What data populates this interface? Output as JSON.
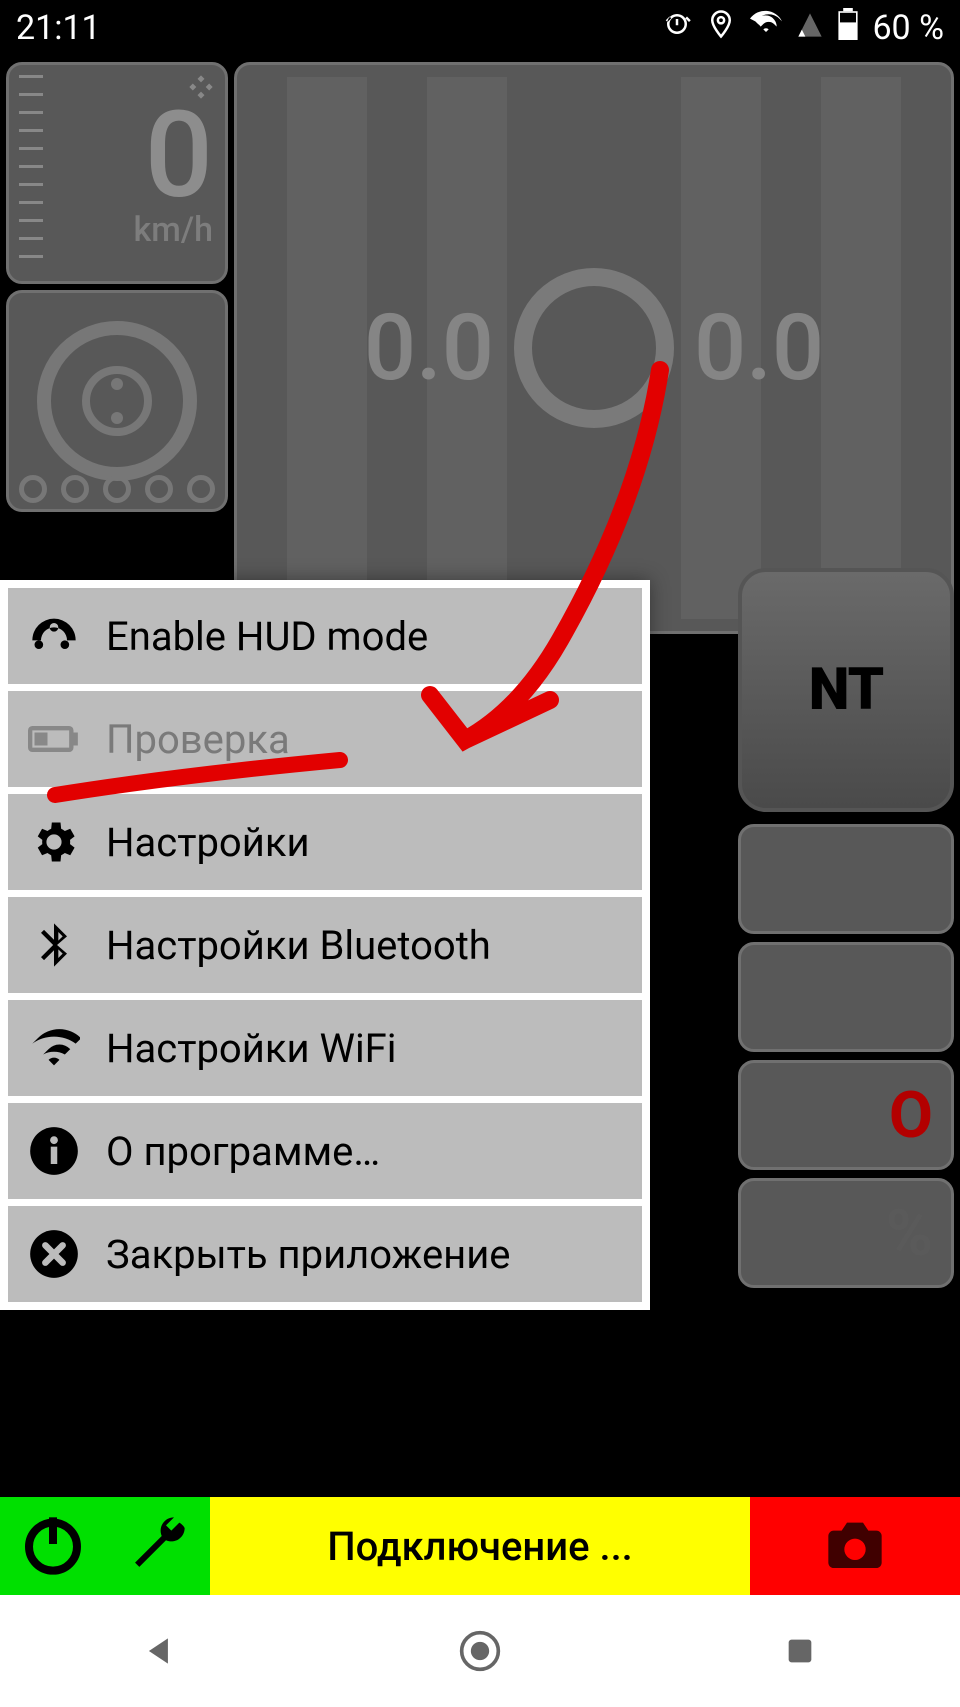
{
  "statusbar": {
    "time": "21:11",
    "battery": "60 %"
  },
  "dashboard": {
    "speed": "0",
    "unit": "km/h",
    "left_value": "0.0",
    "right_value": "0.0",
    "button_fragment": "NT",
    "row_c": "O",
    "row_d": "%"
  },
  "menu": [
    {
      "icon": "dashboard",
      "label": "Enable HUD mode",
      "disabled": false
    },
    {
      "icon": "battery",
      "label": "Проверка",
      "disabled": true
    },
    {
      "icon": "gear",
      "label": "Настройки",
      "disabled": false
    },
    {
      "icon": "bluetooth",
      "label": "Настройки Bluetooth",
      "disabled": false
    },
    {
      "icon": "wifi",
      "label": "Настройки WiFi",
      "disabled": false
    },
    {
      "icon": "info",
      "label": "О программе…",
      "disabled": false
    },
    {
      "icon": "close",
      "label": "Закрыть приложение",
      "disabled": false
    }
  ],
  "actionbar": {
    "status": "Подключение ..."
  }
}
